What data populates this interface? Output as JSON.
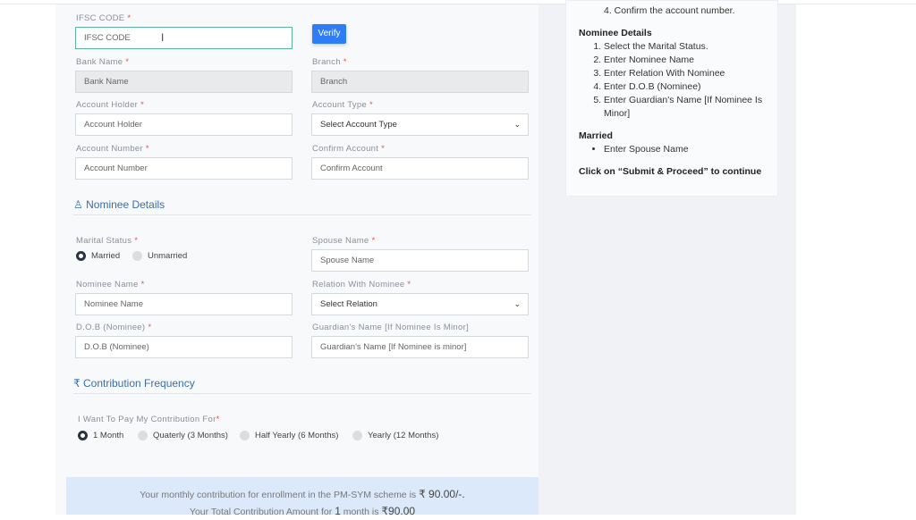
{
  "bank": {
    "ifsc_label": "IFSC CODE",
    "ifsc_placeholder": "IFSC CODE",
    "verify": "Verify",
    "bank_name_label": "Bank Name",
    "bank_name_placeholder": "Bank Name",
    "branch_label": "Branch",
    "branch_placeholder": "Branch",
    "holder_label": "Account Holder",
    "holder_placeholder": "Account Holder",
    "type_label": "Account Type",
    "type_value": "Select Account Type",
    "number_label": "Account Number",
    "number_placeholder": "Account Number",
    "confirm_label": "Confirm Account",
    "confirm_placeholder": "Confirm Account"
  },
  "nominee": {
    "title": "Nominee Details",
    "marital_label": "Marital Status",
    "married": "Married",
    "unmarried": "Unmarried",
    "spouse_label": "Spouse Name",
    "spouse_placeholder": "Spouse Name",
    "name_label": "Nominee Name",
    "name_placeholder": "Nominee Name",
    "relation_label": "Relation With Nominee",
    "relation_value": "Select Relation",
    "dob_label": "D.O.B (Nominee)",
    "dob_placeholder": "D.O.B (Nominee)",
    "guardian_label": "Guardian's Name [If Nominee Is Minor]",
    "guardian_placeholder": "Guardian's Name [If Nominee is minor]"
  },
  "contribution": {
    "title": "Contribution Frequency",
    "question": "I Want To Pay My Contribution For",
    "options": [
      "1 Month",
      "Quaterly (3 Months)",
      "Half Yearly (6 Months)",
      "Yearly (12 Months)"
    ],
    "selected": "1 Month",
    "line1_pre": "Your monthly contribution for enrollment in the PM-SYM scheme is",
    "line1_amt": "₹  90.00/-.",
    "line2_pre": "Your Total Contribution Amount for",
    "line2_n": "1",
    "line2_mid": "month is",
    "line2_amt": "₹90.00"
  },
  "side": {
    "top_item": "4. Confirm the account number.",
    "nominee_title": "Nominee Details",
    "nominee_steps": [
      "Select the Marital Status.",
      "Enter Nominee Name",
      "Enter Relation With Nominee",
      "Enter D.O.B (Nominee)",
      "Enter Guardian's Name [If Nominee Is Minor]"
    ],
    "married_title": "Married",
    "married_steps": [
      "Enter Spouse Name"
    ],
    "footer": "Click on “Submit & Proceed” to continue"
  }
}
